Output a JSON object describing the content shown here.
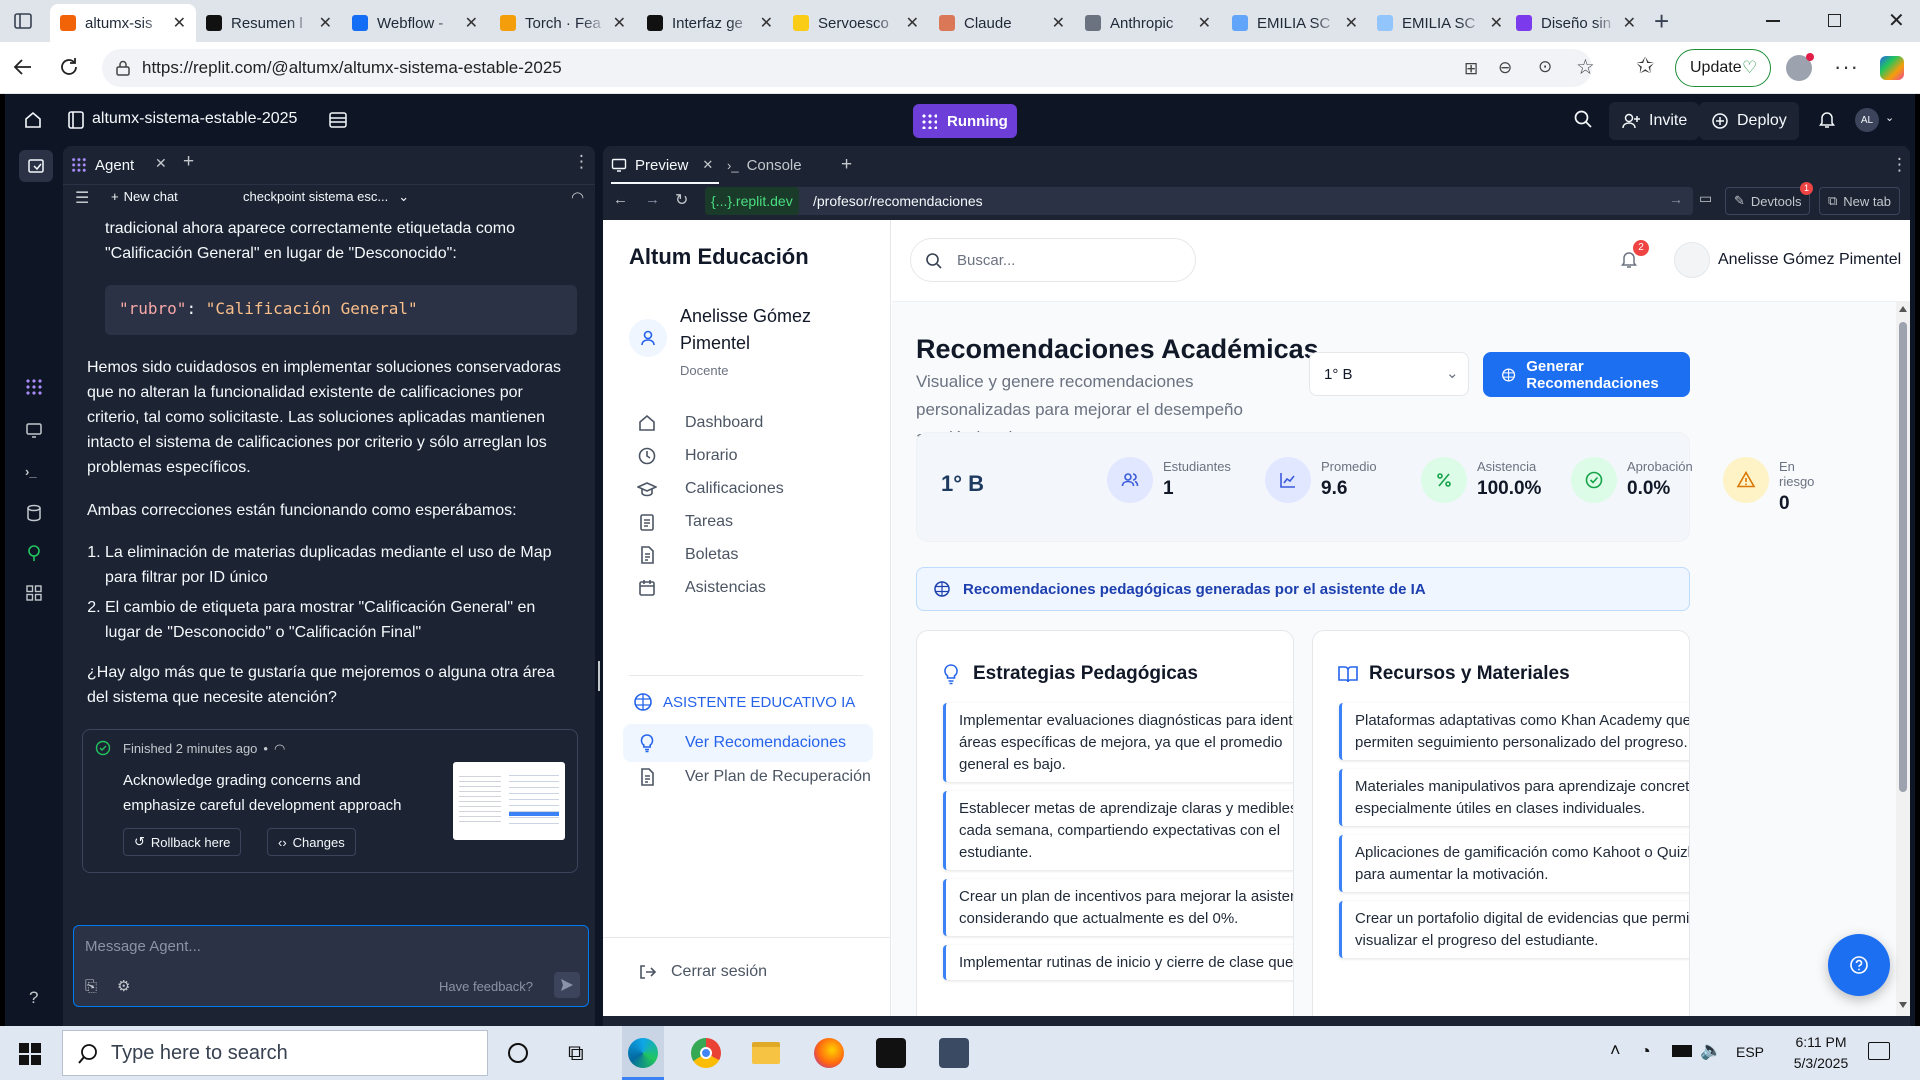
{
  "browser": {
    "tabs": [
      {
        "title": "altumx-sis",
        "color": "#f26207"
      },
      {
        "title": "Resumen l",
        "color": "#111111"
      },
      {
        "title": "Webflow -",
        "color": "#146ef5"
      },
      {
        "title": "Torch · Fea",
        "color": "#f59e0b"
      },
      {
        "title": "Interfaz ge",
        "color": "#111111"
      },
      {
        "title": "Servoesco",
        "color": "#facc15"
      },
      {
        "title": "Claude",
        "color": "#d97757"
      },
      {
        "title": "Anthropic",
        "color": "#6b7280"
      },
      {
        "title": "EMILIA SC",
        "color": "#60a5fa"
      },
      {
        "title": "EMILIA SC",
        "color": "#93c5fd"
      },
      {
        "title": "Diseño sin",
        "color": "#7c3aed"
      }
    ],
    "url": "https://replit.com/@altumx/altumx-sistema-estable-2025",
    "update_label": "Update"
  },
  "replit": {
    "project_name": "altumx-sistema-estable-2025",
    "status": "Running",
    "invite_label": "Invite",
    "deploy_label": "Deploy",
    "avatar_initials": "AL",
    "agent_tab": "Agent",
    "new_chat": "New chat",
    "checkpoint": "checkpoint sistema esc...",
    "preview_tab": "Preview",
    "console_tab": "Console",
    "domain": "{...}.replit.dev",
    "path": "/profesor/recomendaciones",
    "devtools": "Devtools",
    "devtools_badge": "1",
    "new_tab": "New tab"
  },
  "agent": {
    "intro_line1": "tradicional ahora aparece correctamente etiquetada como",
    "intro_line2": "\"Calificación General\" en lugar de \"Desconocido\":",
    "code": "\"rubro\": \"Calificación General\"",
    "code_key": "\"rubro\"",
    "code_colon": ": ",
    "code_value": "\"Calificación General\"",
    "para1": "Hemos sido cuidadosos en implementar soluciones conservadoras que no alteran la funcionalidad existente de calificaciones por criterio, tal como solicitaste. Las soluciones aplicadas mantienen intacto el sistema de calificaciones por criterio y sólo arreglan los problemas específicos.",
    "para2": "Ambas correcciones están funcionando como esperábamos:",
    "list": [
      "La eliminación de materias duplicadas mediante el uso de Map para filtrar por ID único",
      "El cambio de etiqueta para mostrar \"Calificación General\" en lugar de \"Desconocido\" o \"Calificación Final\""
    ],
    "question": "¿Hay algo más que te gustaría que mejoremos o alguna otra área del sistema que necesite atención?",
    "finished": "Finished 2 minutes ago",
    "finished_dot": "•",
    "summary": "Acknowledge grading concerns and emphasize careful development approach",
    "rollback": "Rollback here",
    "changes": "Changes",
    "message_placeholder": "Message Agent...",
    "feedback": "Have feedback?"
  },
  "app": {
    "brand": "Altum Educación",
    "user_name": "Anelisse Gómez Pimentel",
    "user_role": "Docente",
    "nav": [
      {
        "label": "Dashboard",
        "icon": "home-icon"
      },
      {
        "label": "Horario",
        "icon": "clock-icon"
      },
      {
        "label": "Calificaciones",
        "icon": "graduation-cap-icon"
      },
      {
        "label": "Tareas",
        "icon": "clipboard-icon"
      },
      {
        "label": "Boletas",
        "icon": "document-icon"
      },
      {
        "label": "Asistencias",
        "icon": "calendar-icon"
      }
    ],
    "ai_section": "ASISTENTE EDUCATIVO IA",
    "ai_nav": [
      {
        "label": "Ver Recomendaciones",
        "icon": "lightbulb-icon",
        "active": true
      },
      {
        "label": "Ver Plan de Recuperación",
        "icon": "document-icon",
        "active": false
      }
    ],
    "logout": "Cerrar sesión",
    "search_placeholder": "Buscar...",
    "notification_count": "2",
    "top_user": "Anelisse Gómez Pimentel",
    "page_title": "Recomendaciones Académicas",
    "page_subtitle": "Visualice y genere recomendaciones personalizadas para mejorar el desempeño académico de sus grupos.",
    "group_select": "1° B",
    "generate_button": "Generar Recomendaciones",
    "stats_group": "1° B",
    "stats": [
      {
        "label": "Estudiantes",
        "value": "1",
        "icon": "users-icon",
        "bg": "#e0e7ff",
        "fg": "#3b5bdb"
      },
      {
        "label": "Promedio",
        "value": "9.6",
        "icon": "chart-line-icon",
        "bg": "#e0e7ff",
        "fg": "#3b5bdb"
      },
      {
        "label": "Asistencia",
        "value": "100.0%",
        "icon": "percent-icon",
        "bg": "#dcfce7",
        "fg": "#16a34a"
      },
      {
        "label": "Aprobación",
        "value": "0.0%",
        "icon": "check-circle-icon",
        "bg": "#dcfce7",
        "fg": "#16a34a"
      },
      {
        "label": "En riesgo",
        "value": "0",
        "icon": "warning-icon",
        "bg": "#fef3c7",
        "fg": "#d97706"
      }
    ],
    "info_banner": "Recomendaciones pedagógicas generadas por el asistente de IA",
    "strategies_title": "Estrategias Pedagógicas",
    "strategies": [
      "Implementar evaluaciones diagnósticas para identificar áreas específicas de mejora, ya que el promedio general es bajo.",
      "Establecer metas de aprendizaje claras y medibles para cada semana, compartiendo expectativas con el estudiante.",
      "Crear un plan de incentivos para mejorar la asistencia, considerando que actualmente es del 0%.",
      "Implementar rutinas de inicio y cierre de clase que"
    ],
    "resources_title": "Recursos y Materiales",
    "resources": [
      "Plataformas adaptativas como Khan Academy que permiten seguimiento personalizado del progreso.",
      "Materiales manipulativos para aprendizaje concreto, especialmente útiles en clases individuales.",
      "Aplicaciones de gamificación como Kahoot o Quizlet para aumentar la motivación.",
      "Crear un portafolio digital de evidencias que permita visualizar el progreso del estudiante."
    ]
  },
  "taskbar": {
    "search_placeholder": "Type here to search",
    "language": "ESP",
    "time": "6:11 PM",
    "date": "5/3/2025"
  },
  "colors": {
    "replit_bg": "#0e1525",
    "replit_panel": "#1c2333",
    "running": "#6d3fd8",
    "primary": "#1d6ff2",
    "accent_blue": "#2563eb"
  }
}
